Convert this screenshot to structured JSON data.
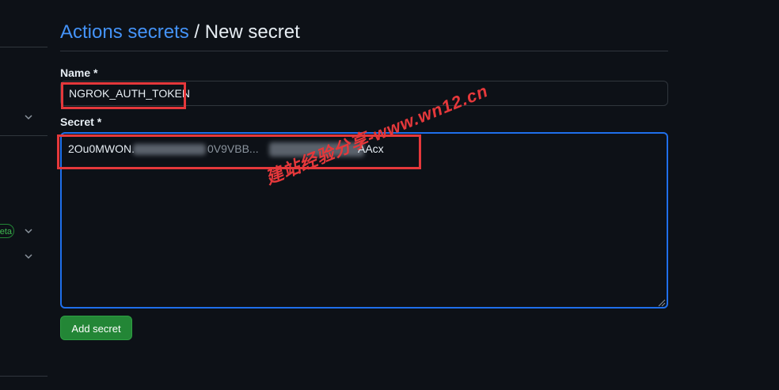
{
  "header": {
    "breadcrumb_link": "Actions secrets",
    "separator": "/",
    "current": "New secret"
  },
  "form": {
    "name_label": "Name *",
    "name_value": "NGROK_AUTH_TOKEN",
    "secret_label": "Secret *",
    "secret_value_start": "2Ou0MWON.",
    "secret_value_mid": "0V9VBB...",
    "secret_value_end": "AAcx",
    "submit_label": "Add secret"
  },
  "sidebar": {
    "badge": "eta"
  },
  "watermark": "建站经验分享-www.wn12.cn",
  "colors": {
    "background": "#0d1117",
    "link": "#4493f8",
    "border": "#30363d",
    "focus": "#1f6feb",
    "button": "#238636",
    "highlight": "#e5383b"
  }
}
